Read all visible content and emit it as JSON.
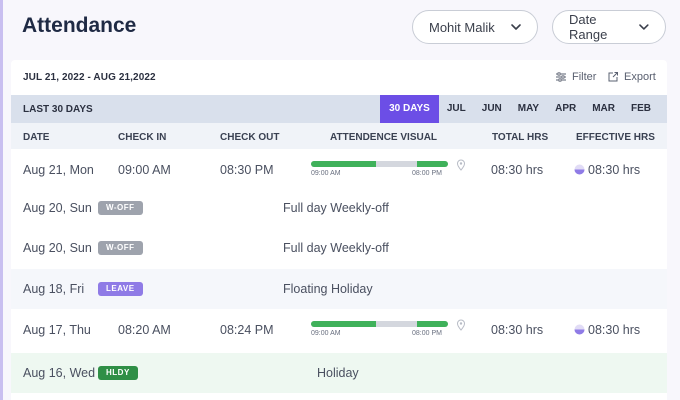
{
  "header": {
    "title": "Attendance",
    "user_selector": "Mohit Malik",
    "date_range_selector": "Date Range"
  },
  "toolbar": {
    "date_range": "JUL 21, 2022 - AUG 21,2022",
    "filter_label": "Filter",
    "export_label": "Export"
  },
  "period_bar": {
    "label": "LAST 30 DAYS",
    "tabs": [
      "30 DAYS",
      "JUL",
      "JUN",
      "MAY",
      "APR",
      "MAR",
      "FEB"
    ],
    "active_tab": "30 DAYS"
  },
  "columns": {
    "date": "DATE",
    "check_in": "CHECK IN",
    "check_out": "CHECK OUT",
    "visual": "ATTENDENCE VISUAL",
    "total": "TOTAL HRS",
    "effective": "EFFECTIVE HRS"
  },
  "rows": [
    {
      "date": "Aug 21, Mon",
      "check_in": "09:00 AM",
      "check_out": "08:30 PM",
      "visual_start": "09:00 AM",
      "visual_end": "08:00 PM",
      "total": "08:30 hrs",
      "effective": "08:30 hrs"
    },
    {
      "date": "Aug 20, Sun",
      "badge": "W-OFF",
      "note": "Full day Weekly-off"
    },
    {
      "date": "Aug 20, Sun",
      "badge": "W-OFF",
      "note": "Full day Weekly-off"
    },
    {
      "date": "Aug 18, Fri",
      "badge": "LEAVE",
      "note": "Floating Holiday"
    },
    {
      "date": "Aug 17, Thu",
      "check_in": "08:20 AM",
      "check_out": "08:24 PM",
      "visual_start": "09:00 AM",
      "visual_end": "08:00 PM",
      "total": "08:30 hrs",
      "effective": "08:30 hrs"
    },
    {
      "date": "Aug 16, Wed",
      "badge": "HLDY",
      "note": "Holiday"
    }
  ],
  "colors": {
    "accent": "#6c4ee6",
    "present_bar": "#3fb15a",
    "holiday_badge": "#2f8f46",
    "leave_badge": "#8f7be6",
    "woff_badge": "#9ea3ad"
  }
}
